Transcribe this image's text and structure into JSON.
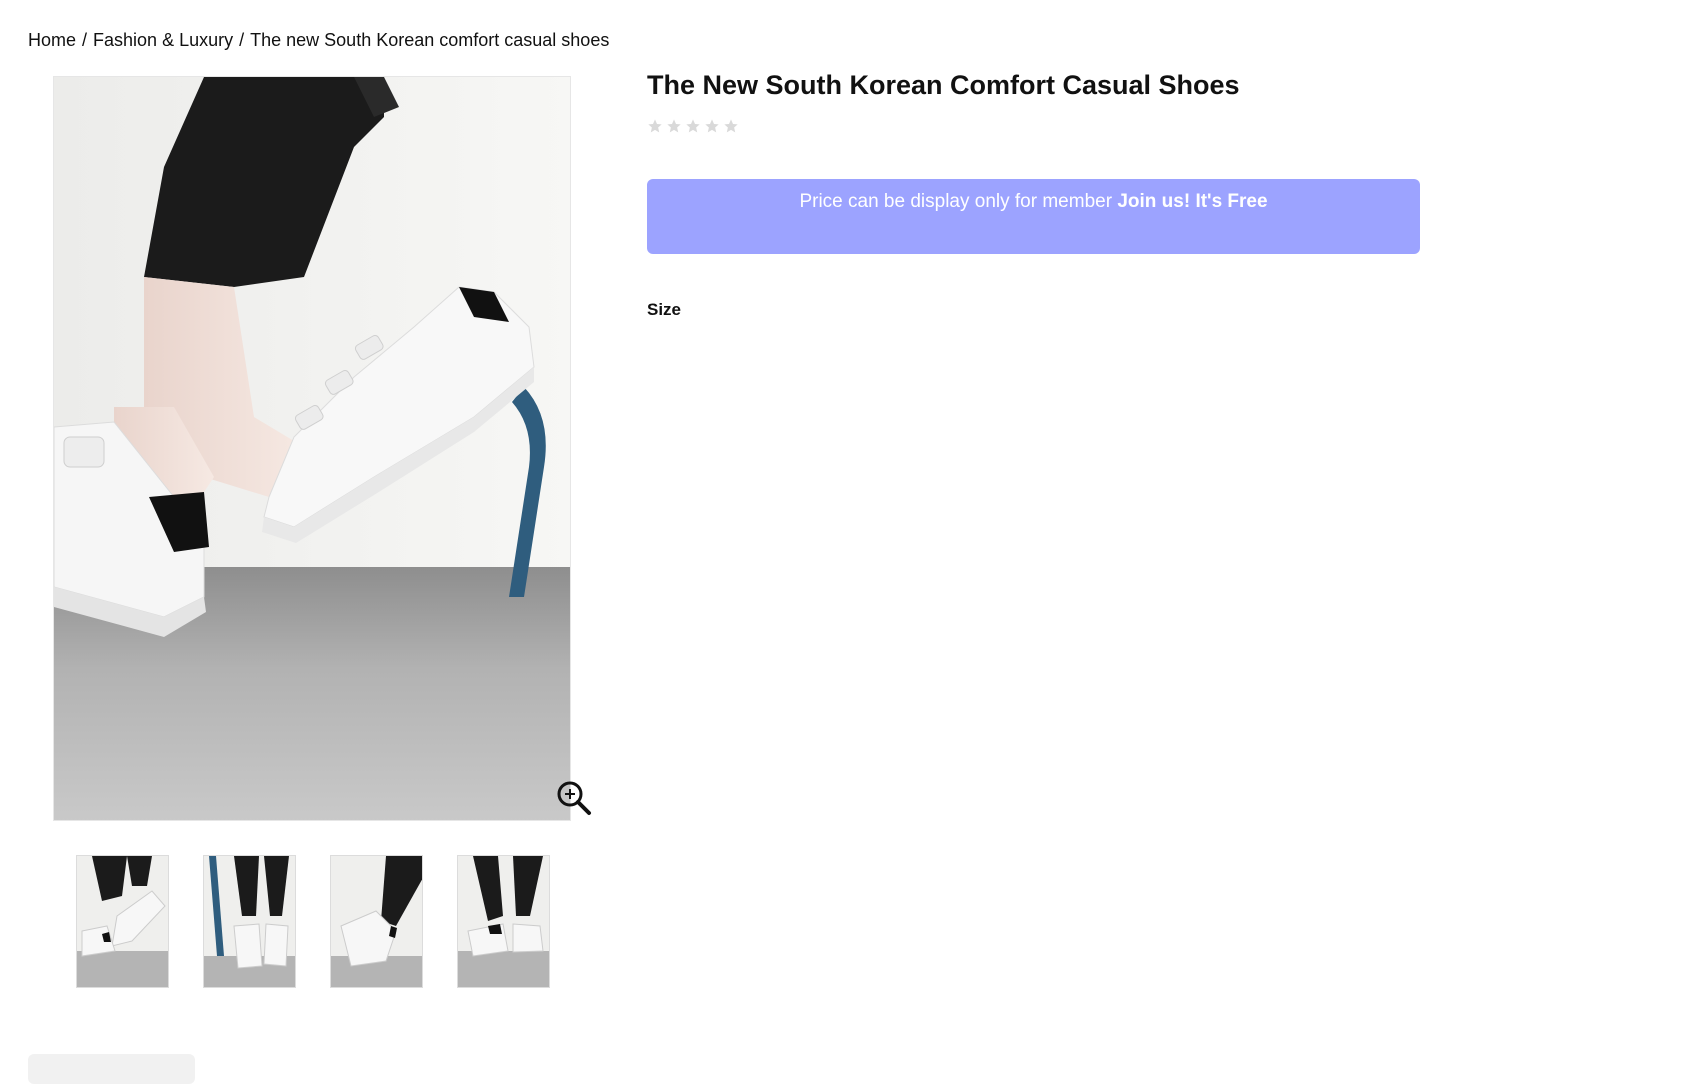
{
  "breadcrumb": {
    "items": [
      "Home",
      "Fashion & Luxury",
      "The new South Korean comfort casual shoes"
    ],
    "separator": "/"
  },
  "product": {
    "title": "The New South Korean Comfort Casual Shoes",
    "rating": 0,
    "rating_max": 5
  },
  "price_notice": {
    "text": "Price can be display only for member ",
    "cta": "Join us! It's Free"
  },
  "options": {
    "size_label": "Size"
  },
  "gallery": {
    "zoom_icon": "zoom-in-icon",
    "thumbnail_count": 4
  },
  "colors": {
    "price_box_bg": "#9ca3ff",
    "star_empty": "#d9d9d9",
    "text": "#111111"
  }
}
